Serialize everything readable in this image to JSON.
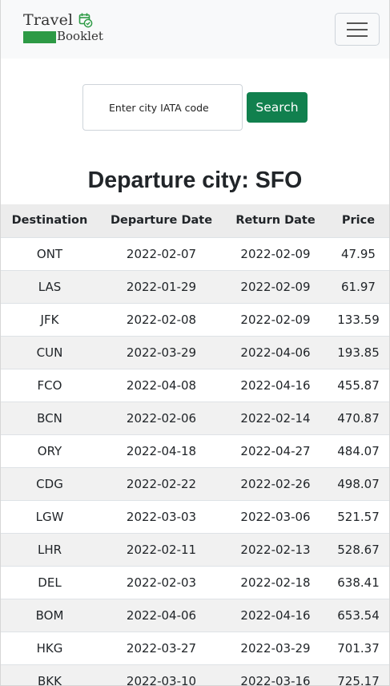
{
  "navbar": {
    "brand_top": "Travel",
    "brand_bottom": "Booklet",
    "logo_icon": "calendar-check-icon",
    "brand_color": "#2d9a45",
    "menu_icon": "hamburger-menu-icon"
  },
  "search": {
    "placeholder": "Enter city IATA code",
    "value": "",
    "button_label": "Search",
    "button_color": "#11804e"
  },
  "heading": "Departure city: SFO",
  "table": {
    "columns": [
      "Destination",
      "Departure Date",
      "Return Date",
      "Price"
    ],
    "rows": [
      [
        "ONT",
        "2022-02-07",
        "2022-02-09",
        "47.95"
      ],
      [
        "LAS",
        "2022-01-29",
        "2022-02-09",
        "61.97"
      ],
      [
        "JFK",
        "2022-02-08",
        "2022-02-09",
        "133.59"
      ],
      [
        "CUN",
        "2022-03-29",
        "2022-04-06",
        "193.85"
      ],
      [
        "FCO",
        "2022-04-08",
        "2022-04-16",
        "455.87"
      ],
      [
        "BCN",
        "2022-02-06",
        "2022-02-14",
        "470.87"
      ],
      [
        "ORY",
        "2022-04-18",
        "2022-04-27",
        "484.07"
      ],
      [
        "CDG",
        "2022-02-22",
        "2022-02-26",
        "498.07"
      ],
      [
        "LGW",
        "2022-03-03",
        "2022-03-06",
        "521.57"
      ],
      [
        "LHR",
        "2022-02-11",
        "2022-02-13",
        "528.67"
      ],
      [
        "DEL",
        "2022-02-03",
        "2022-02-18",
        "638.41"
      ],
      [
        "BOM",
        "2022-04-06",
        "2022-04-16",
        "653.54"
      ],
      [
        "HKG",
        "2022-03-27",
        "2022-03-29",
        "701.37"
      ],
      [
        "BKK",
        "2022-03-10",
        "2022-03-16",
        "725.17"
      ]
    ]
  }
}
